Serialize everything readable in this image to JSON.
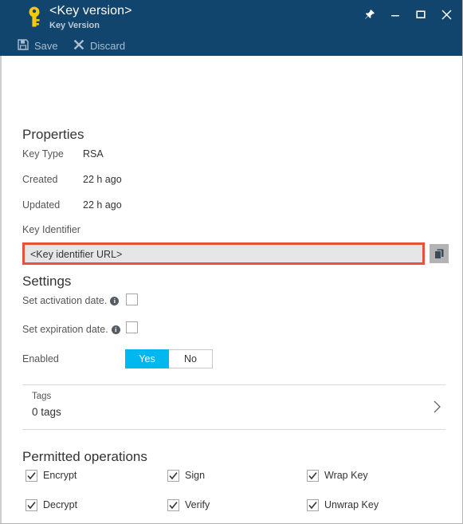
{
  "titlebar": {
    "icon": "key-icon",
    "title": "<Key version>",
    "subtitle": "Key Version",
    "buttons": [
      {
        "name": "pin-icon",
        "label": "Pin"
      },
      {
        "name": "minimize-icon",
        "label": "Minimize"
      },
      {
        "name": "maximize-icon",
        "label": "Maximize"
      },
      {
        "name": "close-icon",
        "label": "Close"
      }
    ],
    "accent_color": "#11456d"
  },
  "commandbar": {
    "save_label": "Save",
    "discard_label": "Discard"
  },
  "properties": {
    "heading": "Properties",
    "rows": [
      {
        "label": "Key Type",
        "value": "RSA"
      },
      {
        "label": "Created",
        "value": "22 h ago"
      },
      {
        "label": "Updated",
        "value": "22 h ago"
      }
    ],
    "key_identifier_label": "Key Identifier",
    "key_identifier_value": "<Key identifier URL>",
    "copy_button": "copy-icon",
    "highlight_color": "#e8523c"
  },
  "settings": {
    "heading": "Settings",
    "activation": {
      "label": "Set activation date.",
      "checked": false
    },
    "expiration": {
      "label": "Set expiration date.",
      "checked": false
    },
    "enabled": {
      "label": "Enabled",
      "yes_label": "Yes",
      "no_label": "No",
      "selected": "Yes",
      "active_color": "#00b7f0"
    }
  },
  "tags": {
    "label": "Tags",
    "value": "0 tags"
  },
  "permitted_operations": {
    "heading": "Permitted operations",
    "items": [
      {
        "label": "Encrypt",
        "checked": true
      },
      {
        "label": "Sign",
        "checked": true
      },
      {
        "label": "Wrap Key",
        "checked": true
      },
      {
        "label": "Decrypt",
        "checked": true
      },
      {
        "label": "Verify",
        "checked": true
      },
      {
        "label": "Unwrap Key",
        "checked": true
      }
    ]
  }
}
